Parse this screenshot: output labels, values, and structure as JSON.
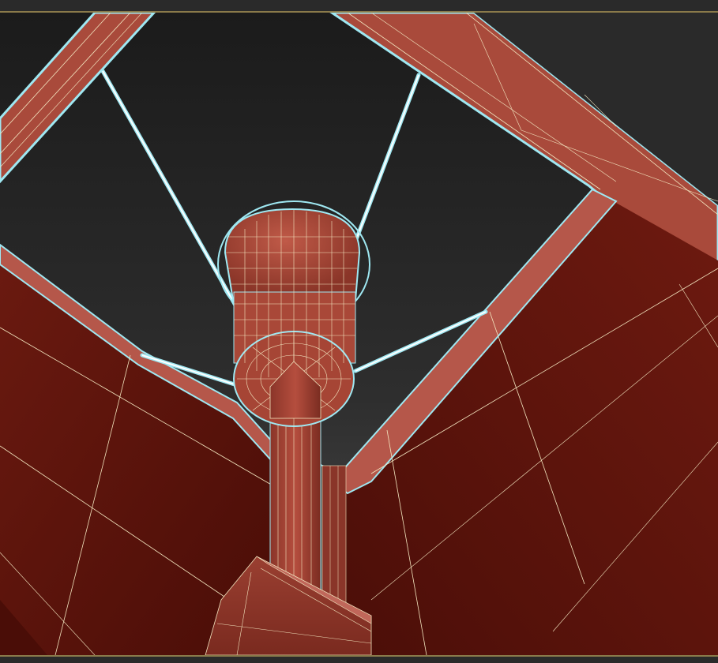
{
  "viewport": {
    "name": "perspective-viewport",
    "render_mode": "shaded-with-wireframe-edges",
    "selection_outline_color": "#9fe8f2",
    "background_gradient": [
      "#1c1c1c",
      "#4a4a4a"
    ]
  },
  "scene": {
    "object": "lamp-model",
    "material_color": "#a0473a",
    "dark_material_color": "#5e130c",
    "edge_color": "#f3e6c0",
    "wire_color": "#e8ffff",
    "parts": [
      "lamp-shade-frame",
      "socket-bulb",
      "support-stem",
      "base-block",
      "support-wires"
    ]
  }
}
